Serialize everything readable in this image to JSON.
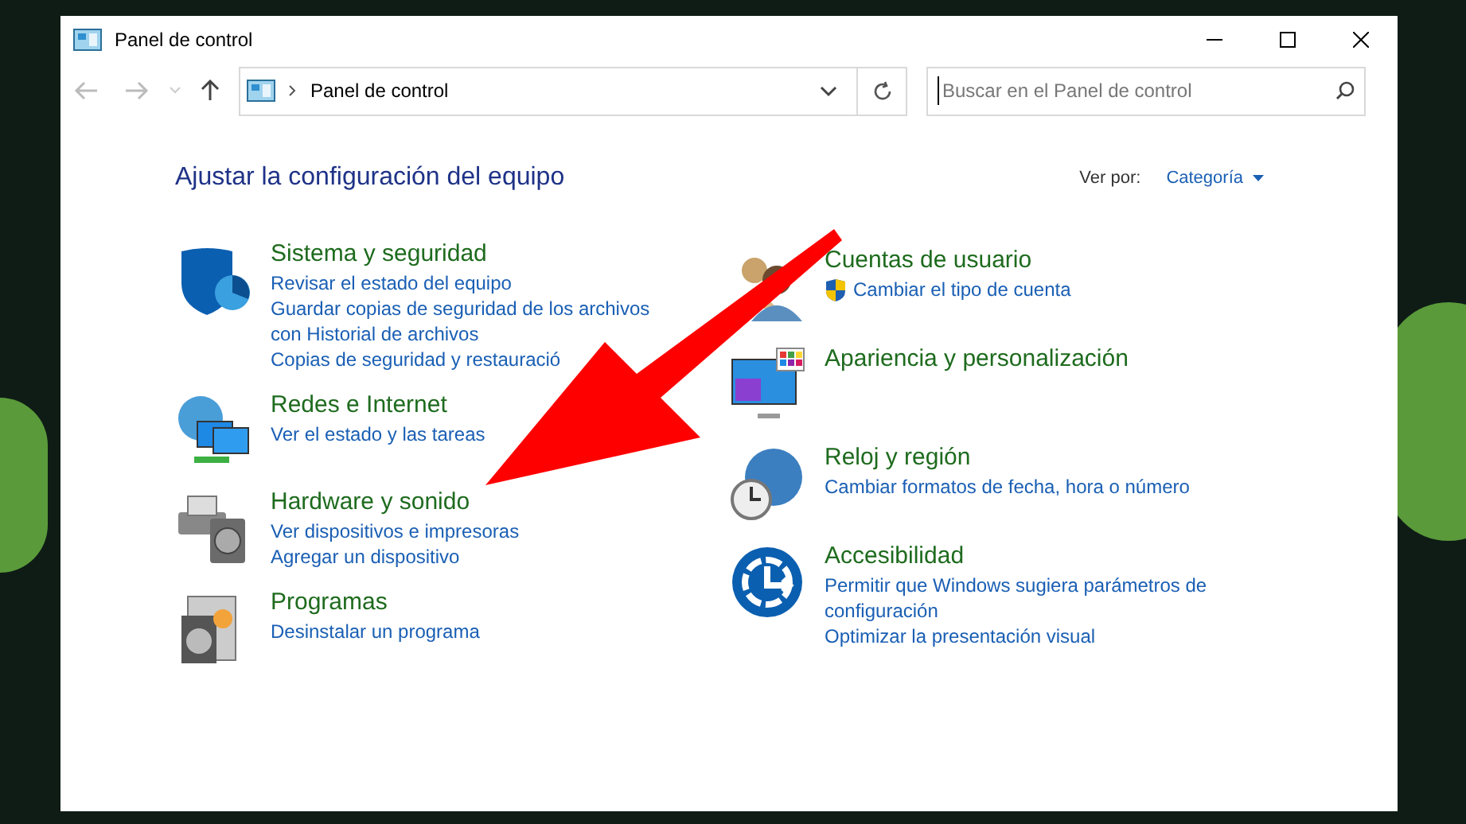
{
  "window": {
    "title": "Panel de control"
  },
  "address_bar": {
    "path": "Panel de control"
  },
  "search": {
    "placeholder": "Buscar en el Panel de control"
  },
  "heading": "Ajustar la configuración del equipo",
  "view_by": {
    "label": "Ver por:",
    "value": "Categoría"
  },
  "left_column": [
    {
      "title": "Sistema y seguridad",
      "links": [
        {
          "text": "Revisar el estado del equipo",
          "shield": false
        },
        {
          "text": "Guardar copias de seguridad de los archivos con Historial de archivos",
          "shield": false
        },
        {
          "text": "Copias de seguridad y restauració",
          "shield": false
        }
      ]
    },
    {
      "title": "Redes e Internet",
      "links": [
        {
          "text": "Ver el estado y las tareas",
          "shield": false
        }
      ]
    },
    {
      "title": "Hardware y sonido",
      "links": [
        {
          "text": "Ver dispositivos e impresoras",
          "shield": false
        },
        {
          "text": "Agregar un dispositivo",
          "shield": false
        }
      ]
    },
    {
      "title": "Programas",
      "links": [
        {
          "text": "Desinstalar un programa",
          "shield": false
        }
      ]
    }
  ],
  "right_column": [
    {
      "title": "Cuentas de usuario",
      "links": [
        {
          "text": "Cambiar el tipo de cuenta",
          "shield": true
        }
      ]
    },
    {
      "title": "Apariencia y personalización"
    },
    {
      "title": "Reloj y región",
      "links": [
        {
          "text": "Cambiar formatos de fecha, hora o número",
          "shield": false
        }
      ]
    },
    {
      "title": "Accesibilidad",
      "links": [
        {
          "text": "Permitir que Windows sugiera parámetros de configuración",
          "shield": false
        },
        {
          "text": "Optimizar la presentación visual",
          "shield": false
        }
      ]
    }
  ]
}
